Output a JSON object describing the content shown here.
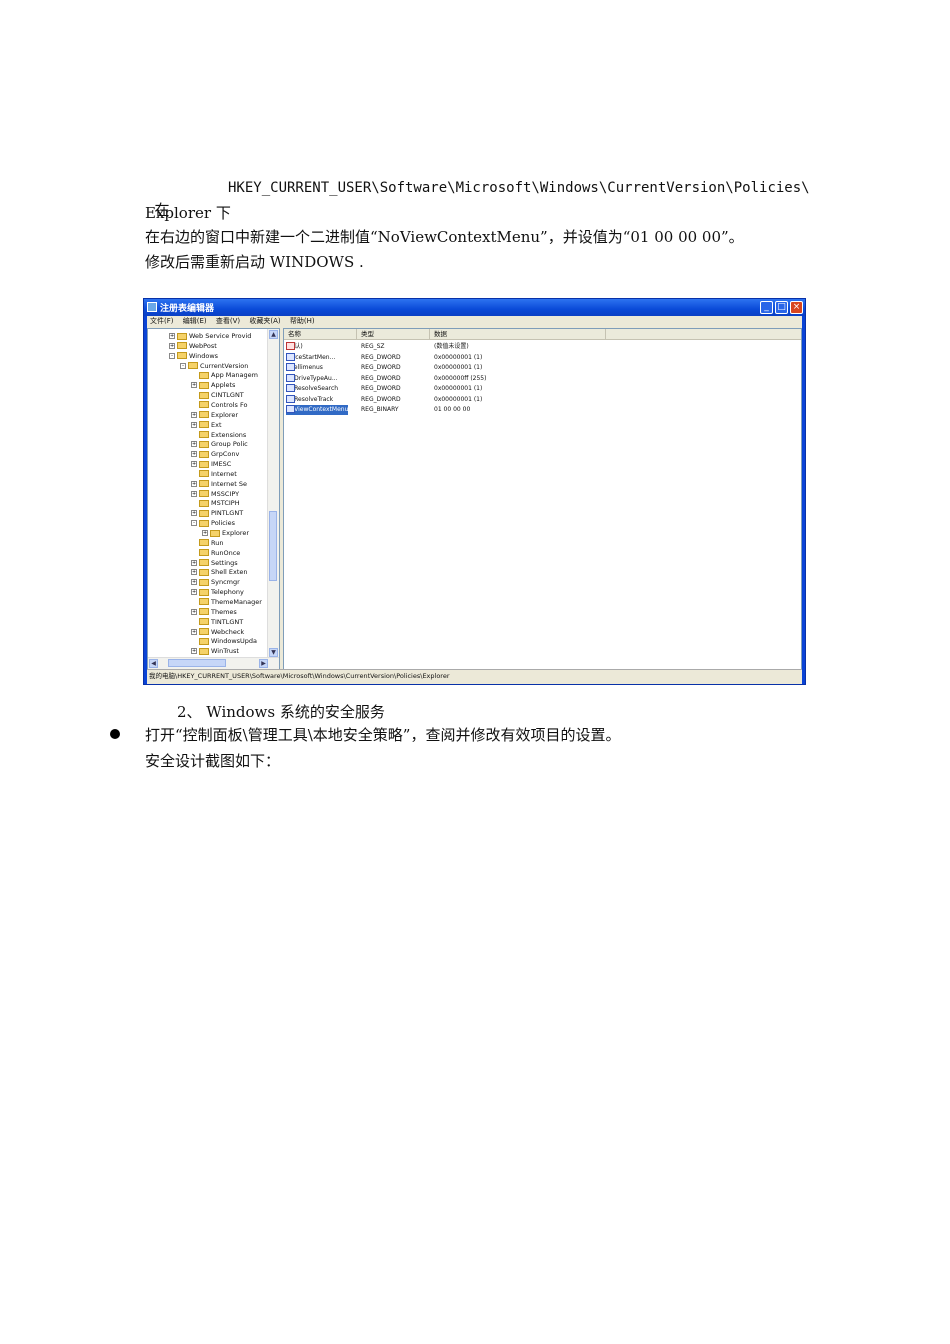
{
  "doc": {
    "line1_prefix": "在",
    "line1_path": "HKEY_CURRENT_USER\\Software\\Microsoft\\Windows\\CurrentVersion\\Policies\\",
    "line2": "Explorer 下",
    "line3": "在右边的窗口中新建一个二进制值“NoViewContextMenu”，并设值为“01 00 00 00”。",
    "line4": "修改后需重新启动 WINDOWS .",
    "heading": "2、 Windows 系统的安全服务",
    "bullet_text": "打开“控制面板\\管理工具\\本地安全策略”，查阅并修改有效项目的设置。",
    "line_after": "安全设计截图如下："
  },
  "window": {
    "title": "注册表编辑器",
    "menu": [
      "文件(F)",
      "编辑(E)",
      "查看(V)",
      "收藏夹(A)",
      "帮助(H)"
    ],
    "minimize": "_",
    "maximize": "□",
    "close": "×",
    "tree": [
      {
        "label": "Web Service Provid",
        "expander": "+",
        "indent": 1
      },
      {
        "label": "WebPost",
        "expander": "+",
        "indent": 1
      },
      {
        "label": "Windows",
        "expander": "-",
        "indent": 1
      },
      {
        "label": "CurrentVersion",
        "expander": "-",
        "indent": 2
      },
      {
        "label": "App Managem",
        "expander": "",
        "indent": 3
      },
      {
        "label": "Applets",
        "expander": "+",
        "indent": 3
      },
      {
        "label": "CINTLGNT",
        "expander": "",
        "indent": 3
      },
      {
        "label": "Controls Fo",
        "expander": "",
        "indent": 3
      },
      {
        "label": "Explorer",
        "expander": "+",
        "indent": 3
      },
      {
        "label": "Ext",
        "expander": "+",
        "indent": 3
      },
      {
        "label": "Extensions",
        "expander": "",
        "indent": 3
      },
      {
        "label": "Group Polic",
        "expander": "+",
        "indent": 3
      },
      {
        "label": "GrpConv",
        "expander": "+",
        "indent": 3
      },
      {
        "label": "IMESC",
        "expander": "+",
        "indent": 3
      },
      {
        "label": "Internet",
        "expander": "",
        "indent": 3
      },
      {
        "label": "Internet Se",
        "expander": "+",
        "indent": 3
      },
      {
        "label": "MSSCIPY",
        "expander": "+",
        "indent": 3
      },
      {
        "label": "MSTCIPH",
        "expander": "",
        "indent": 3
      },
      {
        "label": "PINTLGNT",
        "expander": "+",
        "indent": 3
      },
      {
        "label": "Policies",
        "expander": "-",
        "indent": 3
      },
      {
        "label": "Explorer",
        "expander": "+",
        "indent": 4
      },
      {
        "label": "Run",
        "expander": "",
        "indent": 3
      },
      {
        "label": "RunOnce",
        "expander": "",
        "indent": 3
      },
      {
        "label": "Settings",
        "expander": "+",
        "indent": 3
      },
      {
        "label": "Shell Exten",
        "expander": "+",
        "indent": 3
      },
      {
        "label": "Syncmgr",
        "expander": "+",
        "indent": 3
      },
      {
        "label": "Telephony",
        "expander": "+",
        "indent": 3
      },
      {
        "label": "ThemeManager",
        "expander": "",
        "indent": 3
      },
      {
        "label": "Themes",
        "expander": "+",
        "indent": 3
      },
      {
        "label": "TINTLGNT",
        "expander": "",
        "indent": 3
      },
      {
        "label": "Webcheck",
        "expander": "+",
        "indent": 3
      },
      {
        "label": "WindowsUpda",
        "expander": "",
        "indent": 3
      },
      {
        "label": "WinTrust",
        "expander": "+",
        "indent": 3
      }
    ],
    "columns": [
      "名称",
      "类型",
      "数据"
    ],
    "values": [
      {
        "name": "(默认)",
        "type": "REG_SZ",
        "data": "(数值未设置)",
        "icon": "string-value-icon",
        "selected": false
      },
      {
        "name": "ForceStartMen...",
        "type": "REG_DWORD",
        "data": "0x00000001 (1)",
        "icon": "binary-value-icon",
        "selected": false
      },
      {
        "name": "Intellimenus",
        "type": "REG_DWORD",
        "data": "0x00000001 (1)",
        "icon": "binary-value-icon",
        "selected": false
      },
      {
        "name": "NoDriveTypeAu...",
        "type": "REG_DWORD",
        "data": "0x000000ff (255)",
        "icon": "binary-value-icon",
        "selected": false
      },
      {
        "name": "NoResolveSearch",
        "type": "REG_DWORD",
        "data": "0x00000001 (1)",
        "icon": "binary-value-icon",
        "selected": false
      },
      {
        "name": "NoResolveTrack",
        "type": "REG_DWORD",
        "data": "0x00000001 (1)",
        "icon": "binary-value-icon",
        "selected": false
      },
      {
        "name": "NoViewContextMenu",
        "type": "REG_BINARY",
        "data": "01 00 00 00",
        "icon": "binary-value-icon",
        "selected": true
      }
    ],
    "status": "我的电脑\\HKEY_CURRENT_USER\\Software\\Microsoft\\Windows\\CurrentVersion\\Policies\\Explorer"
  }
}
